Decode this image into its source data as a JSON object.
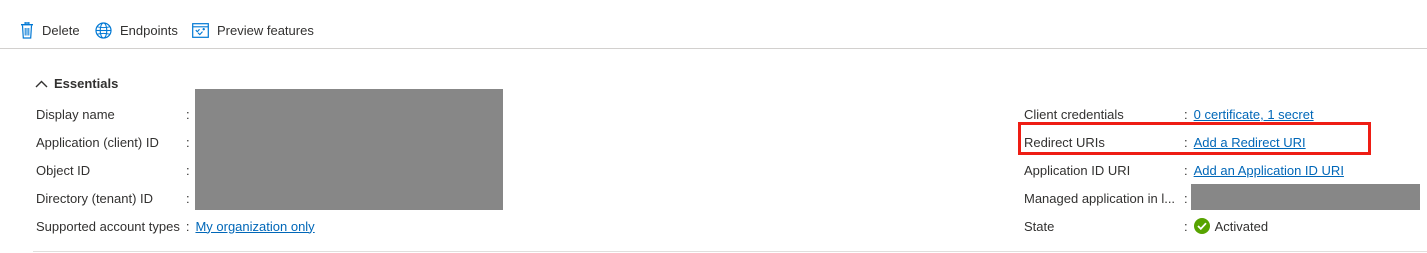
{
  "toolbar": {
    "delete_label": "Delete",
    "endpoints_label": "Endpoints",
    "preview_label": "Preview features"
  },
  "essentials": {
    "title": "Essentials",
    "left": {
      "display_name_label": "Display name",
      "client_id_label": "Application (client) ID",
      "object_id_label": "Object ID",
      "tenant_id_label": "Directory (tenant) ID",
      "account_types_label": "Supported account types",
      "account_types_value": "My organization only"
    },
    "right": {
      "credentials_label": "Client credentials",
      "credentials_value": "0 certificate, 1 secret",
      "redirect_label": "Redirect URIs",
      "redirect_value": "Add a Redirect URI",
      "app_id_uri_label": "Application ID URI",
      "app_id_uri_value": "Add an Application ID URI",
      "managed_app_label": "Managed application in l...",
      "state_label": "State",
      "state_value": "Activated"
    },
    "colon": ":"
  },
  "colors": {
    "link": "#0067b8",
    "icon_blue": "#0078d4",
    "highlight": "#ee1d14",
    "activated_green": "#57a300",
    "redaction_gray": "#878787"
  },
  "icons": [
    "trash-icon",
    "globe-icon",
    "preview-icon",
    "chevron-up-icon",
    "check-circle-icon"
  ]
}
